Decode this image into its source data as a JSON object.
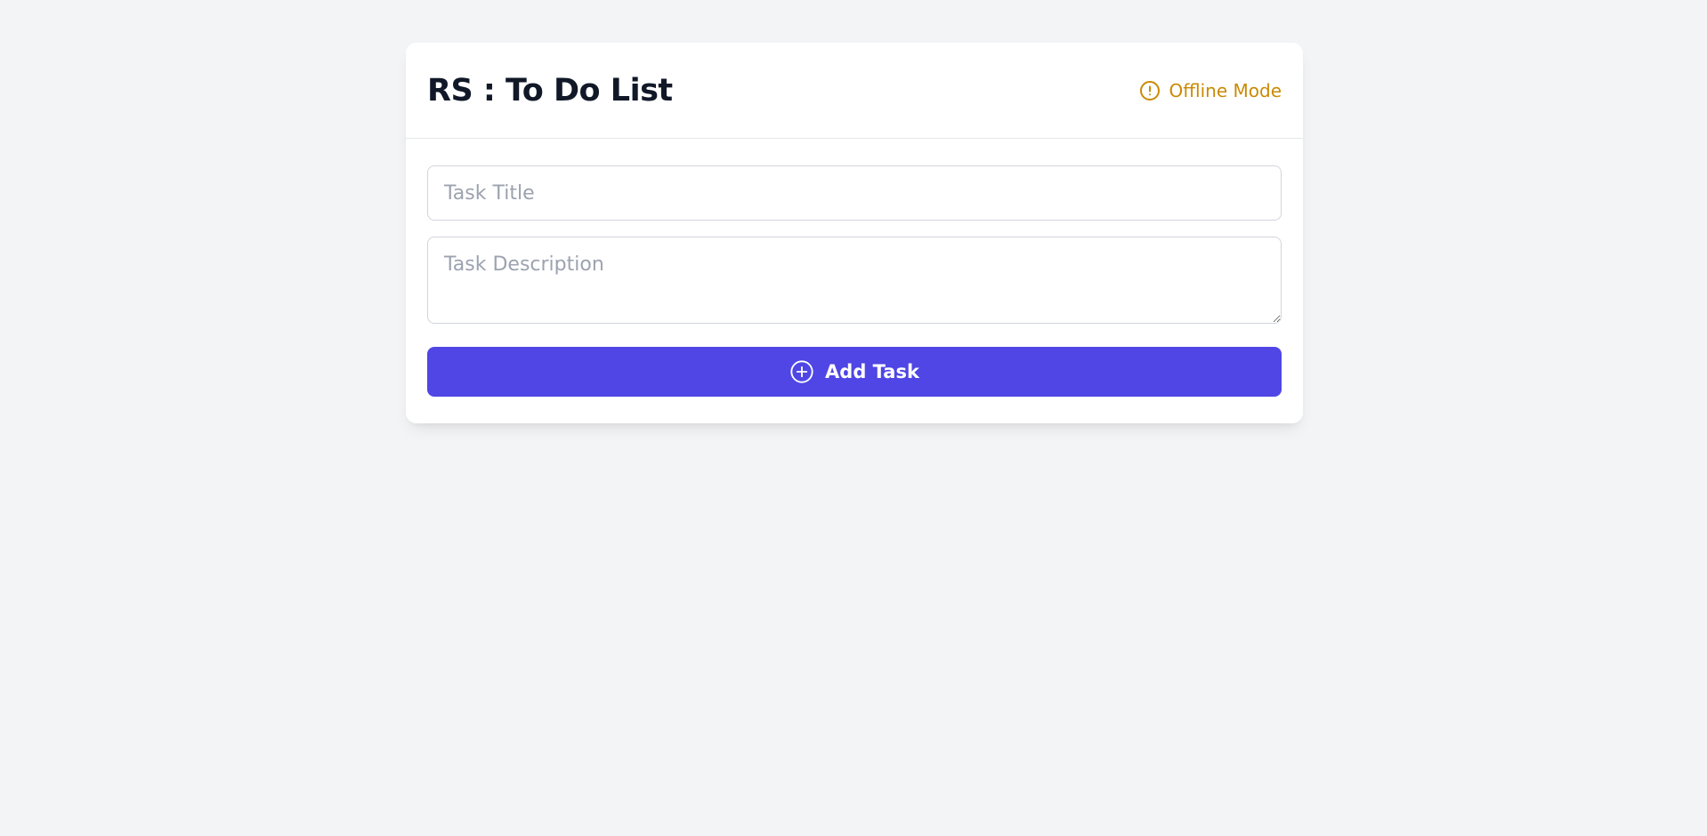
{
  "app": {
    "title": "RS : To Do List"
  },
  "status": {
    "label": "Offline Mode",
    "icon": "alert-circle-icon",
    "color": "#ca8a04"
  },
  "form": {
    "title_placeholder": "Task Title",
    "title_value": "",
    "description_placeholder": "Task Description",
    "description_value": "",
    "add_button_label": "Add Task",
    "add_button_icon": "plus-circle-icon",
    "accent_color": "#4f46e5"
  }
}
